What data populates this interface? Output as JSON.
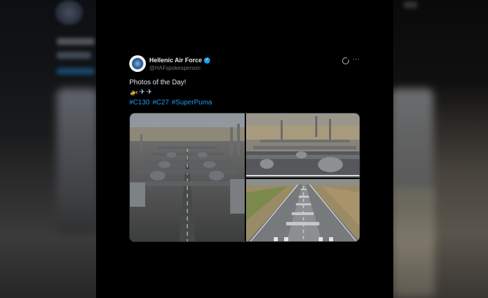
{
  "tweet": {
    "display_name": "Hellenic Air Force",
    "handle": "@HAFspokesperson",
    "text": "Photos of the Day!",
    "emojis": [
      "🚁",
      "✈",
      "✈"
    ],
    "hashtags": [
      "#C130",
      "#C27",
      "#SuperPuma"
    ],
    "icons": {
      "verified": "verified-badge-icon",
      "grok": "grok-icon",
      "more": "more-icon"
    },
    "colors": {
      "accent": "#1d9bf0",
      "text": "#e7e9ea",
      "muted": "#71767b"
    }
  },
  "media": {
    "photos": [
      "c130-runway-lineup",
      "aircraft-formation-taxi",
      "runway-aerial-lineup"
    ]
  }
}
